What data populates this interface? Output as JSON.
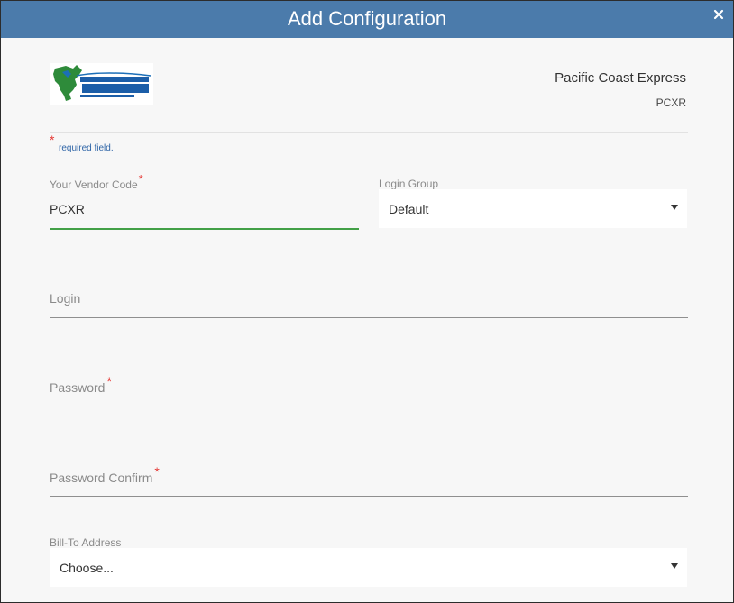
{
  "dialog": {
    "title": "Add Configuration",
    "close_icon": "close-icon"
  },
  "vendor": {
    "logo_icon": "pacific-coast-express-logo",
    "name": "Pacific Coast Express",
    "code": "PCXR"
  },
  "required_note": {
    "star": "*",
    "text": "required field."
  },
  "form": {
    "vendor_code": {
      "label": "Your Vendor Code",
      "required": "*",
      "value": "PCXR"
    },
    "login_group": {
      "label": "Login Group",
      "selected": "Default"
    },
    "login": {
      "label": "Login",
      "value": ""
    },
    "password": {
      "label": "Password",
      "required": "*",
      "value": ""
    },
    "password_confirm": {
      "label": "Password Confirm",
      "required": "*",
      "value": ""
    },
    "bill_to": {
      "label": "Bill-To Address",
      "selected": "Choose..."
    }
  },
  "colors": {
    "header": "#4b7bab",
    "required": "#e53935",
    "active_underline": "#43a047",
    "note_text": "#2f65a7"
  }
}
